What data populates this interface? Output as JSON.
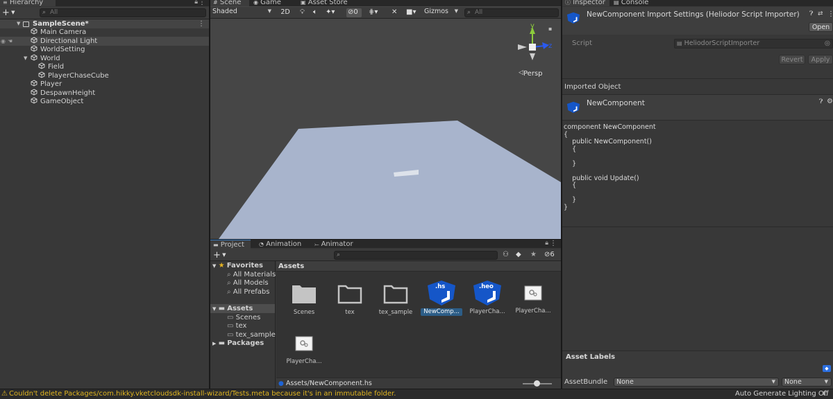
{
  "hierarchy": {
    "tab_label": "Hierarchy",
    "search_placeholder": "All",
    "add_label": "+",
    "scene_name": "SampleScene*",
    "items": [
      {
        "label": "Main Camera"
      },
      {
        "label": "Directional Light"
      },
      {
        "label": "WorldSetting"
      },
      {
        "label": "World"
      },
      {
        "label": "Field"
      },
      {
        "label": "PlayerChaseCube"
      },
      {
        "label": "Player"
      },
      {
        "label": "DespawnHeight"
      },
      {
        "label": "GameObject"
      }
    ]
  },
  "scene_view": {
    "tabs": [
      {
        "label": "Scene"
      },
      {
        "label": "Game"
      },
      {
        "label": "Asset Store"
      }
    ],
    "shading_mode": "Shaded",
    "mode_2d": "2D",
    "hidden_count": "0",
    "gizmos_label": "Gizmos",
    "search_placeholder": "All",
    "persp_label": "Persp",
    "axis_y": "y",
    "axis_z": "z",
    "colors": {
      "background": "#464646",
      "plane": "#a8b4cc",
      "axis_y": "#8ccc3c",
      "axis_z": "#2a5af0",
      "axis_x": "#f04444"
    }
  },
  "project": {
    "tabs": [
      {
        "label": "Project"
      },
      {
        "label": "Animation"
      },
      {
        "label": "Animator"
      }
    ],
    "add_label": "+",
    "hidden_count": "6",
    "favorites_label": "Favorites",
    "favorites": [
      {
        "label": "All Materials"
      },
      {
        "label": "All Models"
      },
      {
        "label": "All Prefabs"
      }
    ],
    "assets_label": "Assets",
    "asset_folders": [
      {
        "label": "Scenes"
      },
      {
        "label": "tex"
      },
      {
        "label": "tex_sample"
      }
    ],
    "packages_label": "Packages",
    "breadcrumb": "Assets",
    "grid_items": [
      {
        "label": "Scenes",
        "kind": "folder-filled"
      },
      {
        "label": "tex",
        "kind": "folder"
      },
      {
        "label": "tex_sample",
        "kind": "folder"
      },
      {
        "label": "NewComp...",
        "kind": "hs-script",
        "badge": ".hs",
        "selected": true
      },
      {
        "label": "PlayerCha...",
        "kind": "heo-script",
        "badge": ".heo"
      },
      {
        "label": "PlayerCha...",
        "kind": "prefab"
      },
      {
        "label": "PlayerCha...",
        "kind": "prefab"
      }
    ],
    "footer_path": "Assets/NewComponent.hs"
  },
  "inspector": {
    "tabs": [
      {
        "label": "Inspector"
      },
      {
        "label": "Console"
      }
    ],
    "header_title": "NewComponent Import Settings (Heliodor Script Importer)",
    "open_label": "Open",
    "script_label": "Script",
    "script_value": "HeliodorScriptImporter",
    "revert_label": "Revert",
    "apply_label": "Apply",
    "imported_object_label": "Imported Object",
    "object_name": "NewComponent",
    "code": "component NewComponent\n{\n    public NewComponent()\n    {\n\n    }\n\n    public void Update()\n    {\n\n    }\n}",
    "asset_labels_title": "Asset Labels",
    "asset_bundle_label": "AssetBundle",
    "asset_bundle_value": "None",
    "asset_variant_value": "None"
  },
  "status_bar": {
    "message": "Couldn't delete Packages/com.hikky.vketcloudsdk-install-wizard/Tests.meta because it's in an immutable folder.",
    "lighting": "Auto Generate Lighting Off",
    "warning_color": "#e0b520"
  }
}
